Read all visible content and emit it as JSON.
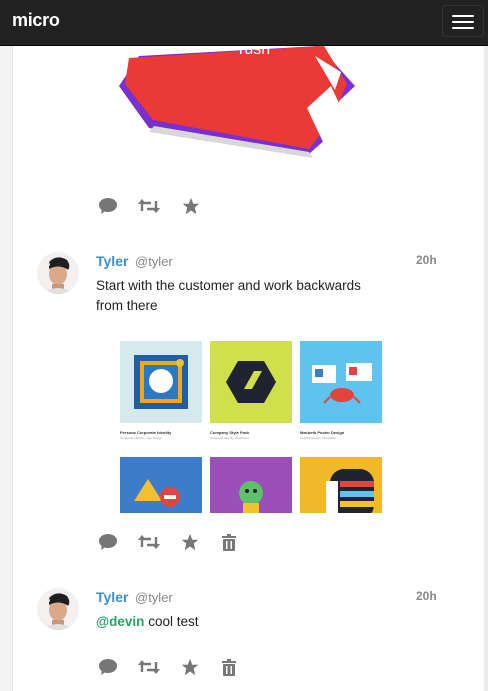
{
  "app": {
    "brand": "micro"
  },
  "hero": {
    "box_text": "rush"
  },
  "posts": [
    {
      "name": "Tyler",
      "handle": "@tyler",
      "time": "20h",
      "text": "Start with the customer and work backwards from there",
      "gallery": [
        {
          "title": "Persona Corporate Identity",
          "sub": "Corporate Identity, Logo Design"
        },
        {
          "title": "Company Style Pack",
          "sub": "Corporate Identity, Illustration"
        },
        {
          "title": "Macbeth Poster Design",
          "sub": "Graphic Design, Illustration"
        }
      ]
    },
    {
      "name": "Tyler",
      "handle": "@tyler",
      "time": "20h",
      "mention": "@devin",
      "text": " cool test"
    }
  ],
  "colors": {
    "link": "#3a8fd6",
    "mention": "#2aa36a",
    "icon": "#777777",
    "nav": "#222222"
  },
  "icons": [
    "comment-icon",
    "retweet-icon",
    "star-icon",
    "trash-icon"
  ]
}
